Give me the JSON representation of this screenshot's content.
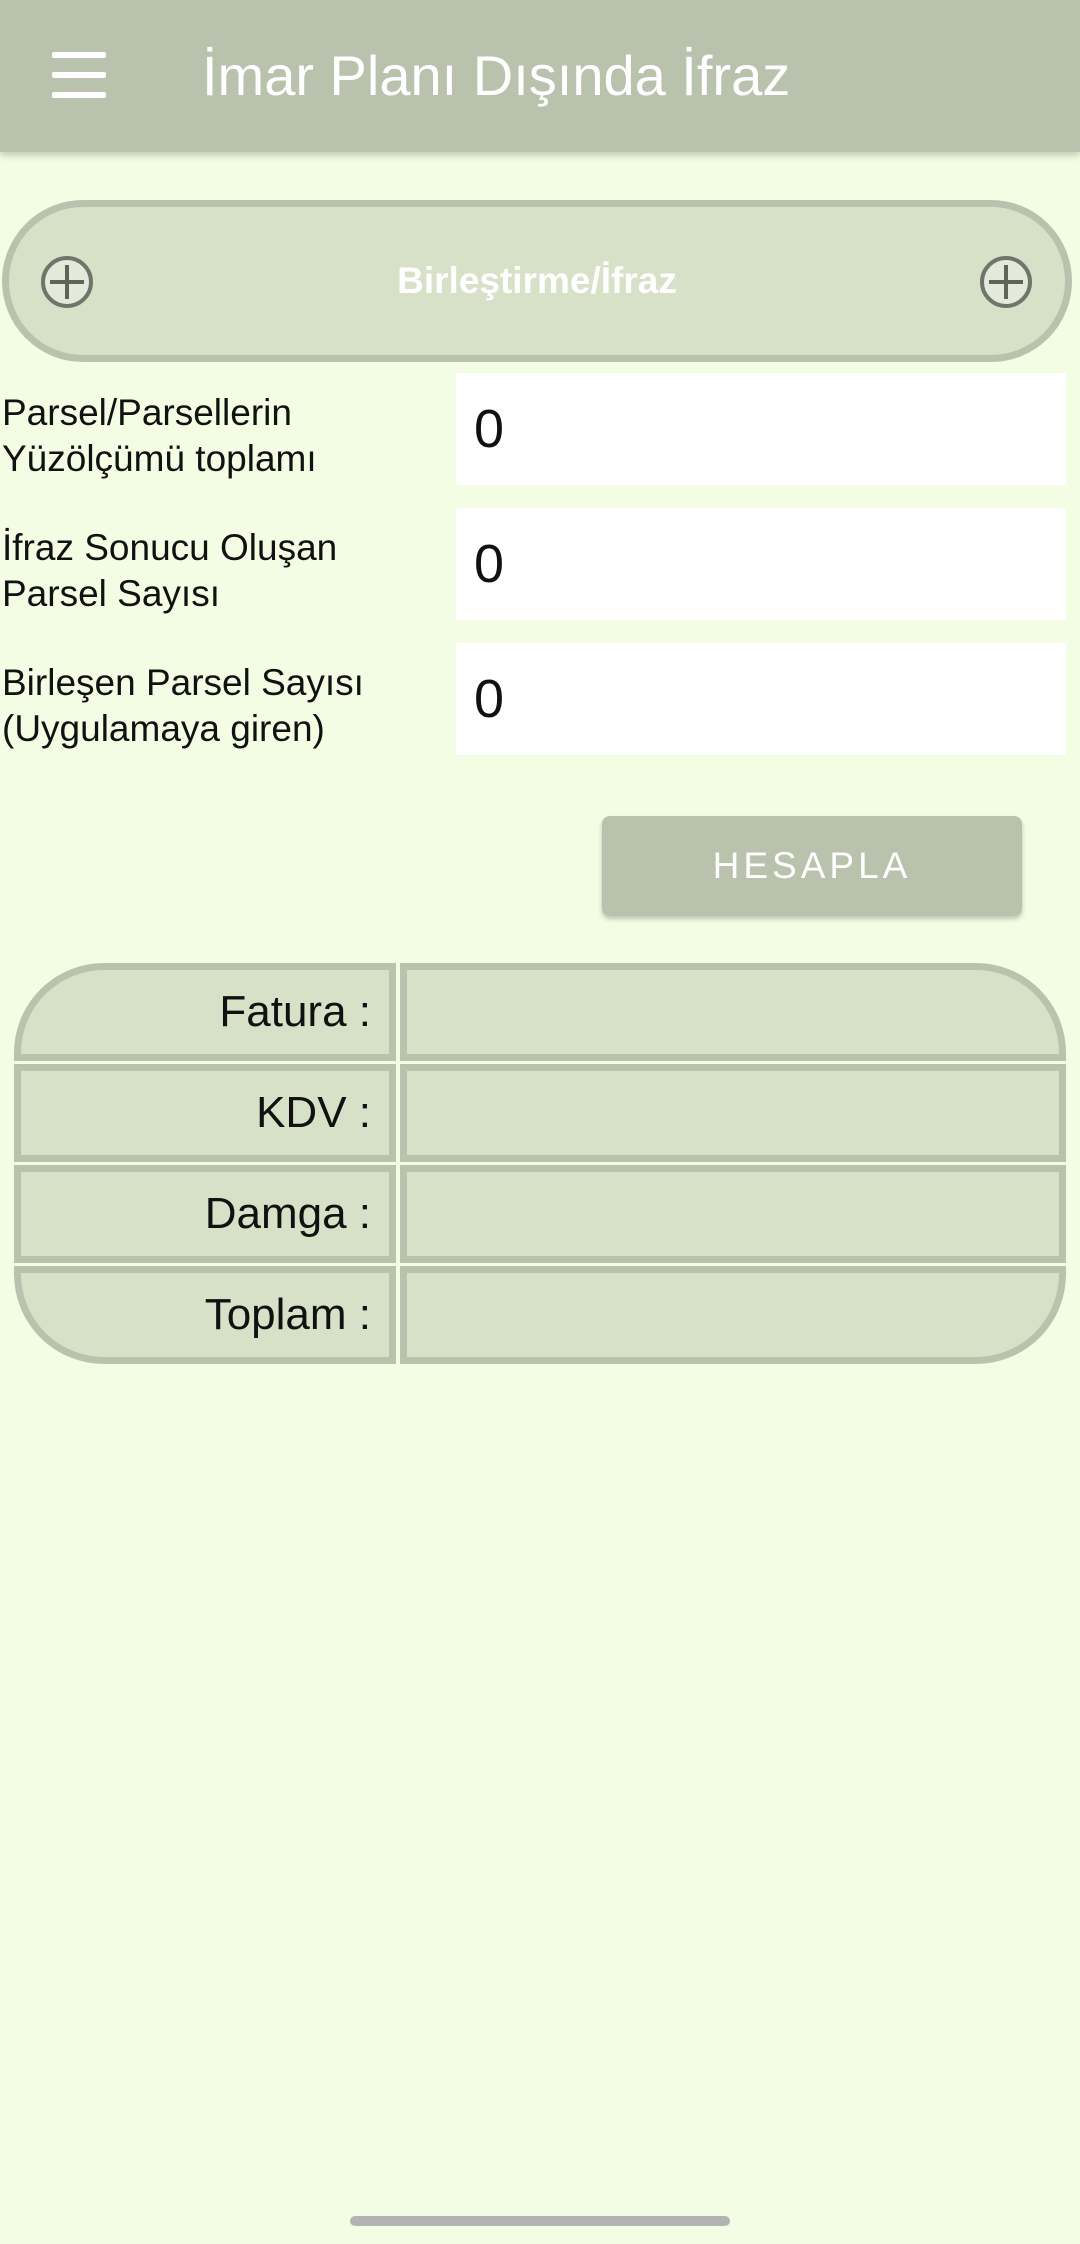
{
  "appbar": {
    "title": "İmar Planı Dışında İfraz",
    "menu_icon": "hamburger-menu-icon"
  },
  "section": {
    "title": "Birleştirme/İfraz",
    "left_icon": "plus-circle-icon",
    "right_icon": "plus-circle-icon"
  },
  "fields": [
    {
      "label": "Parsel/Parsellerin Yüzölçümü toplamı",
      "value": "0"
    },
    {
      "label": "İfraz Sonucu Oluşan Parsel Sayısı",
      "value": "0"
    },
    {
      "label": "Birleşen Parsel Sayısı (Uygulamaya giren)",
      "value": "0"
    }
  ],
  "calculate_button": {
    "label": "HESAPLA"
  },
  "results": [
    {
      "label": "Fatura :",
      "value": ""
    },
    {
      "label": "KDV :",
      "value": ""
    },
    {
      "label": "Damga :",
      "value": ""
    },
    {
      "label": "Toplam :",
      "value": ""
    }
  ],
  "colors": {
    "background": "#f2fde3",
    "appbar": "#b9c2ad",
    "panel": "#d7e1c7",
    "border": "#b9c2ad"
  }
}
